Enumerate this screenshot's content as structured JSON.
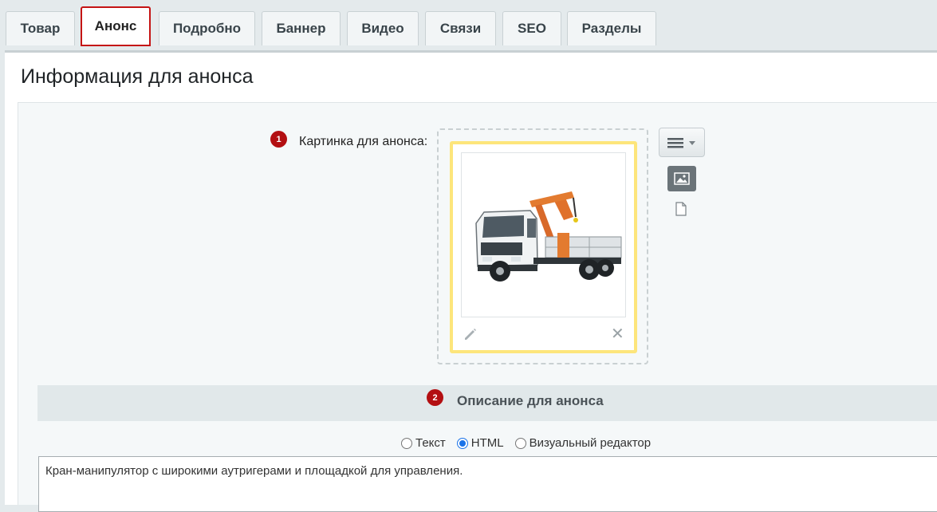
{
  "tabs": [
    "Товар",
    "Анонс",
    "Подробно",
    "Баннер",
    "Видео",
    "Связи",
    "SEO",
    "Разделы"
  ],
  "active_tab": "Анонс",
  "panel": {
    "title": "Информация для анонса"
  },
  "picture": {
    "step": "1",
    "label": "Картинка для анонса:"
  },
  "description": {
    "step": "2",
    "title": "Описание для анонса",
    "options": [
      "Текст",
      "HTML",
      "Визуальный редактор"
    ],
    "selected": "HTML",
    "text": "Кран-манипулятор с широкими аутригерами и площадкой для управления."
  },
  "colors": {
    "accent_red": "#b30f12",
    "card_border": "#fde57b",
    "radio_blue": "#1a73e8"
  }
}
